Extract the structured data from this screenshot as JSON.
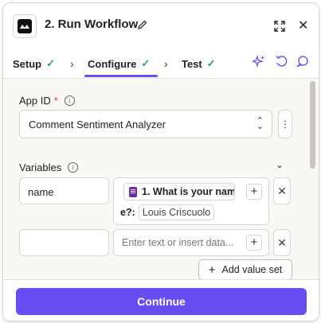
{
  "header": {
    "title": "2. Run Workflow"
  },
  "tabs": [
    {
      "label": "Setup",
      "done": true
    },
    {
      "label": "Configure",
      "done": true
    },
    {
      "label": "Test",
      "done": true
    }
  ],
  "fields": {
    "app_id": {
      "label": "App ID",
      "required_mark": "*",
      "value": "Comment Sentiment Analyzer"
    },
    "variables": {
      "label": "Variables",
      "rows": [
        {
          "key": "name",
          "value_pill": "1. What is your nam",
          "value_pill_cont": "e?:",
          "value_answer": "Louis Criscuolo"
        },
        {
          "key": "",
          "placeholder": "Enter text or insert data..."
        }
      ],
      "add_label": "Add value set"
    }
  },
  "footer": {
    "continue_label": "Continue"
  },
  "colors": {
    "accent": "#6a4cf5",
    "check": "#2e9e5b",
    "form_icon": "#6b2aa8"
  }
}
